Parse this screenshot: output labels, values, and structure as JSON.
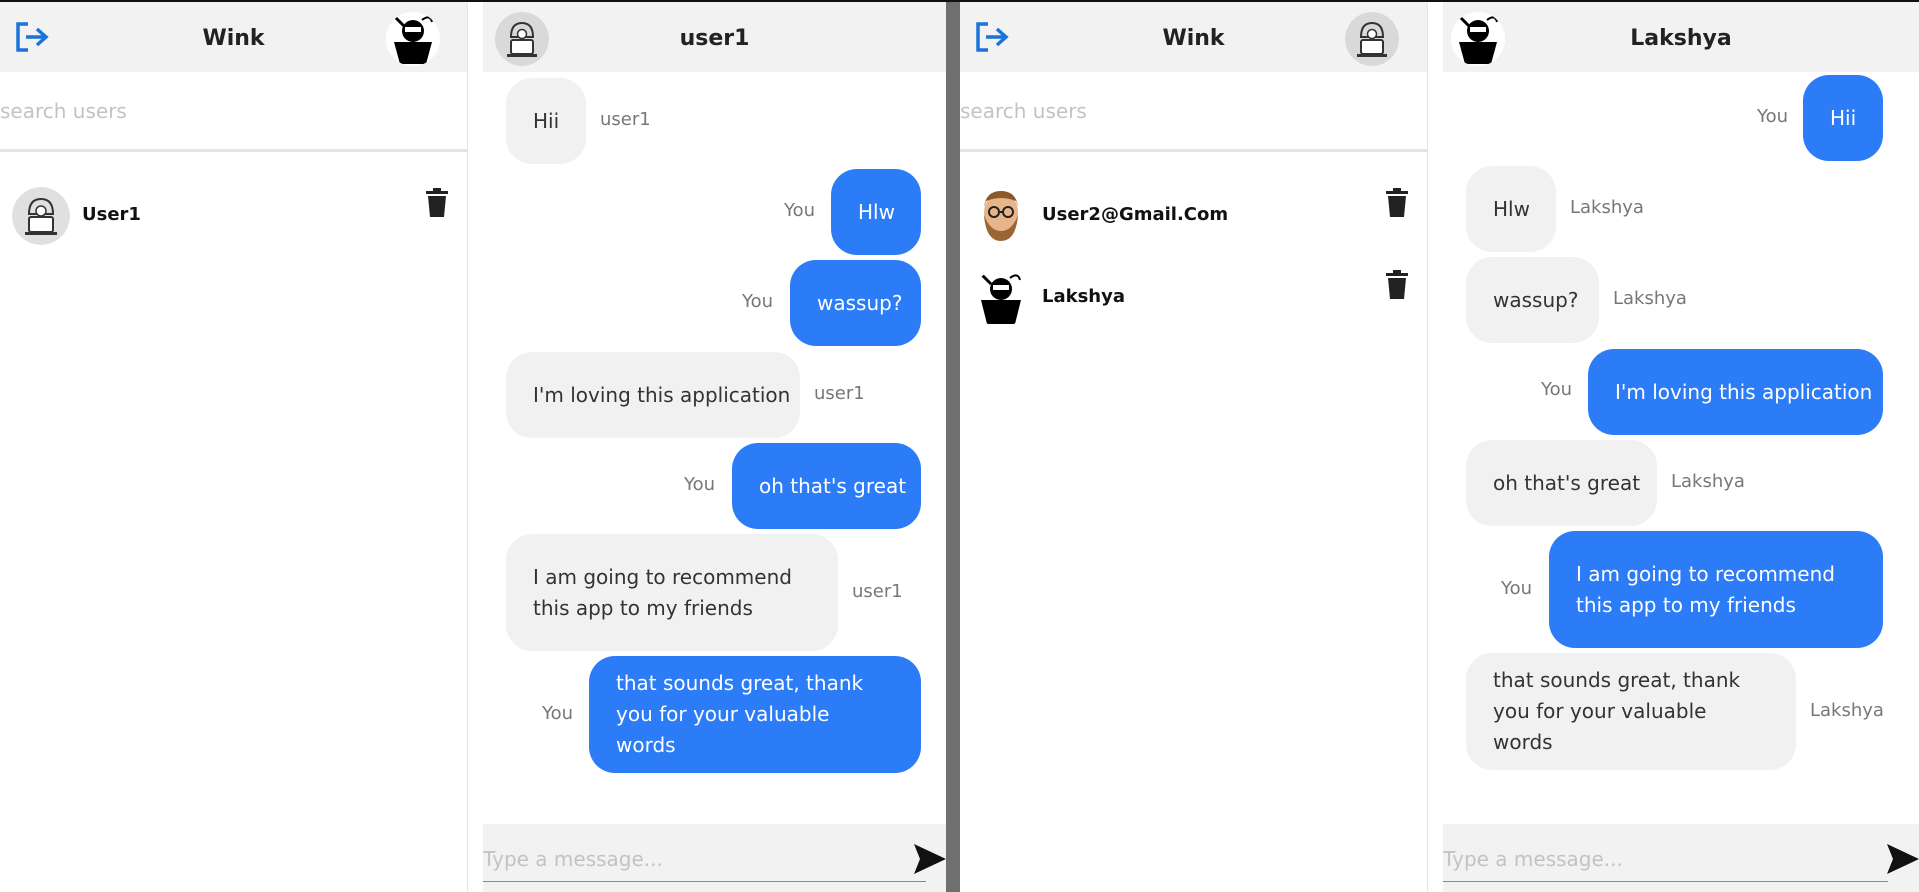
{
  "colors": {
    "accent": "#2b7cf6",
    "header_bg": "#f2f2f2",
    "incoming_bubble": "#f1f1f1",
    "logout_icon": "#1a73d9"
  },
  "left_window": {
    "sidebar": {
      "title": "Wink",
      "search": {
        "placeholder": "search users",
        "value": ""
      },
      "users": [
        {
          "name": "User1",
          "avatar": "hacker-avatar-icon"
        }
      ]
    },
    "chat": {
      "title": "user1",
      "messages": [
        {
          "from": "user1",
          "text": "Hii",
          "dir": "in"
        },
        {
          "from": "You",
          "text": "Hlw",
          "dir": "out"
        },
        {
          "from": "You",
          "text": "wassup?",
          "dir": "out"
        },
        {
          "from": "user1",
          "text": "I'm loving this application",
          "dir": "in"
        },
        {
          "from": "You",
          "text": "oh that's great",
          "dir": "out"
        },
        {
          "from": "user1",
          "text": "I am going to recommend this app to my friends",
          "dir": "in"
        },
        {
          "from": "You",
          "text": "that sounds great, thank you for your valuable words",
          "dir": "out"
        }
      ],
      "composer": {
        "placeholder": "Type a message..."
      }
    }
  },
  "right_window": {
    "sidebar": {
      "title": "Wink",
      "search": {
        "placeholder": "search users",
        "value": ""
      },
      "users": [
        {
          "name": "User2@Gmail.Com",
          "avatar": "bearded-man-avatar-icon"
        },
        {
          "name": "Lakshya",
          "avatar": "ninja-avatar-icon"
        }
      ]
    },
    "chat": {
      "title": "Lakshya",
      "messages": [
        {
          "from": "You",
          "text": "Hii",
          "dir": "out"
        },
        {
          "from": "Lakshya",
          "text": "Hlw",
          "dir": "in"
        },
        {
          "from": "Lakshya",
          "text": "wassup?",
          "dir": "in"
        },
        {
          "from": "You",
          "text": "I'm loving this application",
          "dir": "out"
        },
        {
          "from": "Lakshya",
          "text": "oh that's great",
          "dir": "in"
        },
        {
          "from": "You",
          "text": "I am going to recommend this app to my friends",
          "dir": "out"
        },
        {
          "from": "Lakshya",
          "text": "that sounds great, thank you for your valuable words",
          "dir": "in"
        }
      ],
      "composer": {
        "placeholder": "Type a message..."
      }
    }
  }
}
